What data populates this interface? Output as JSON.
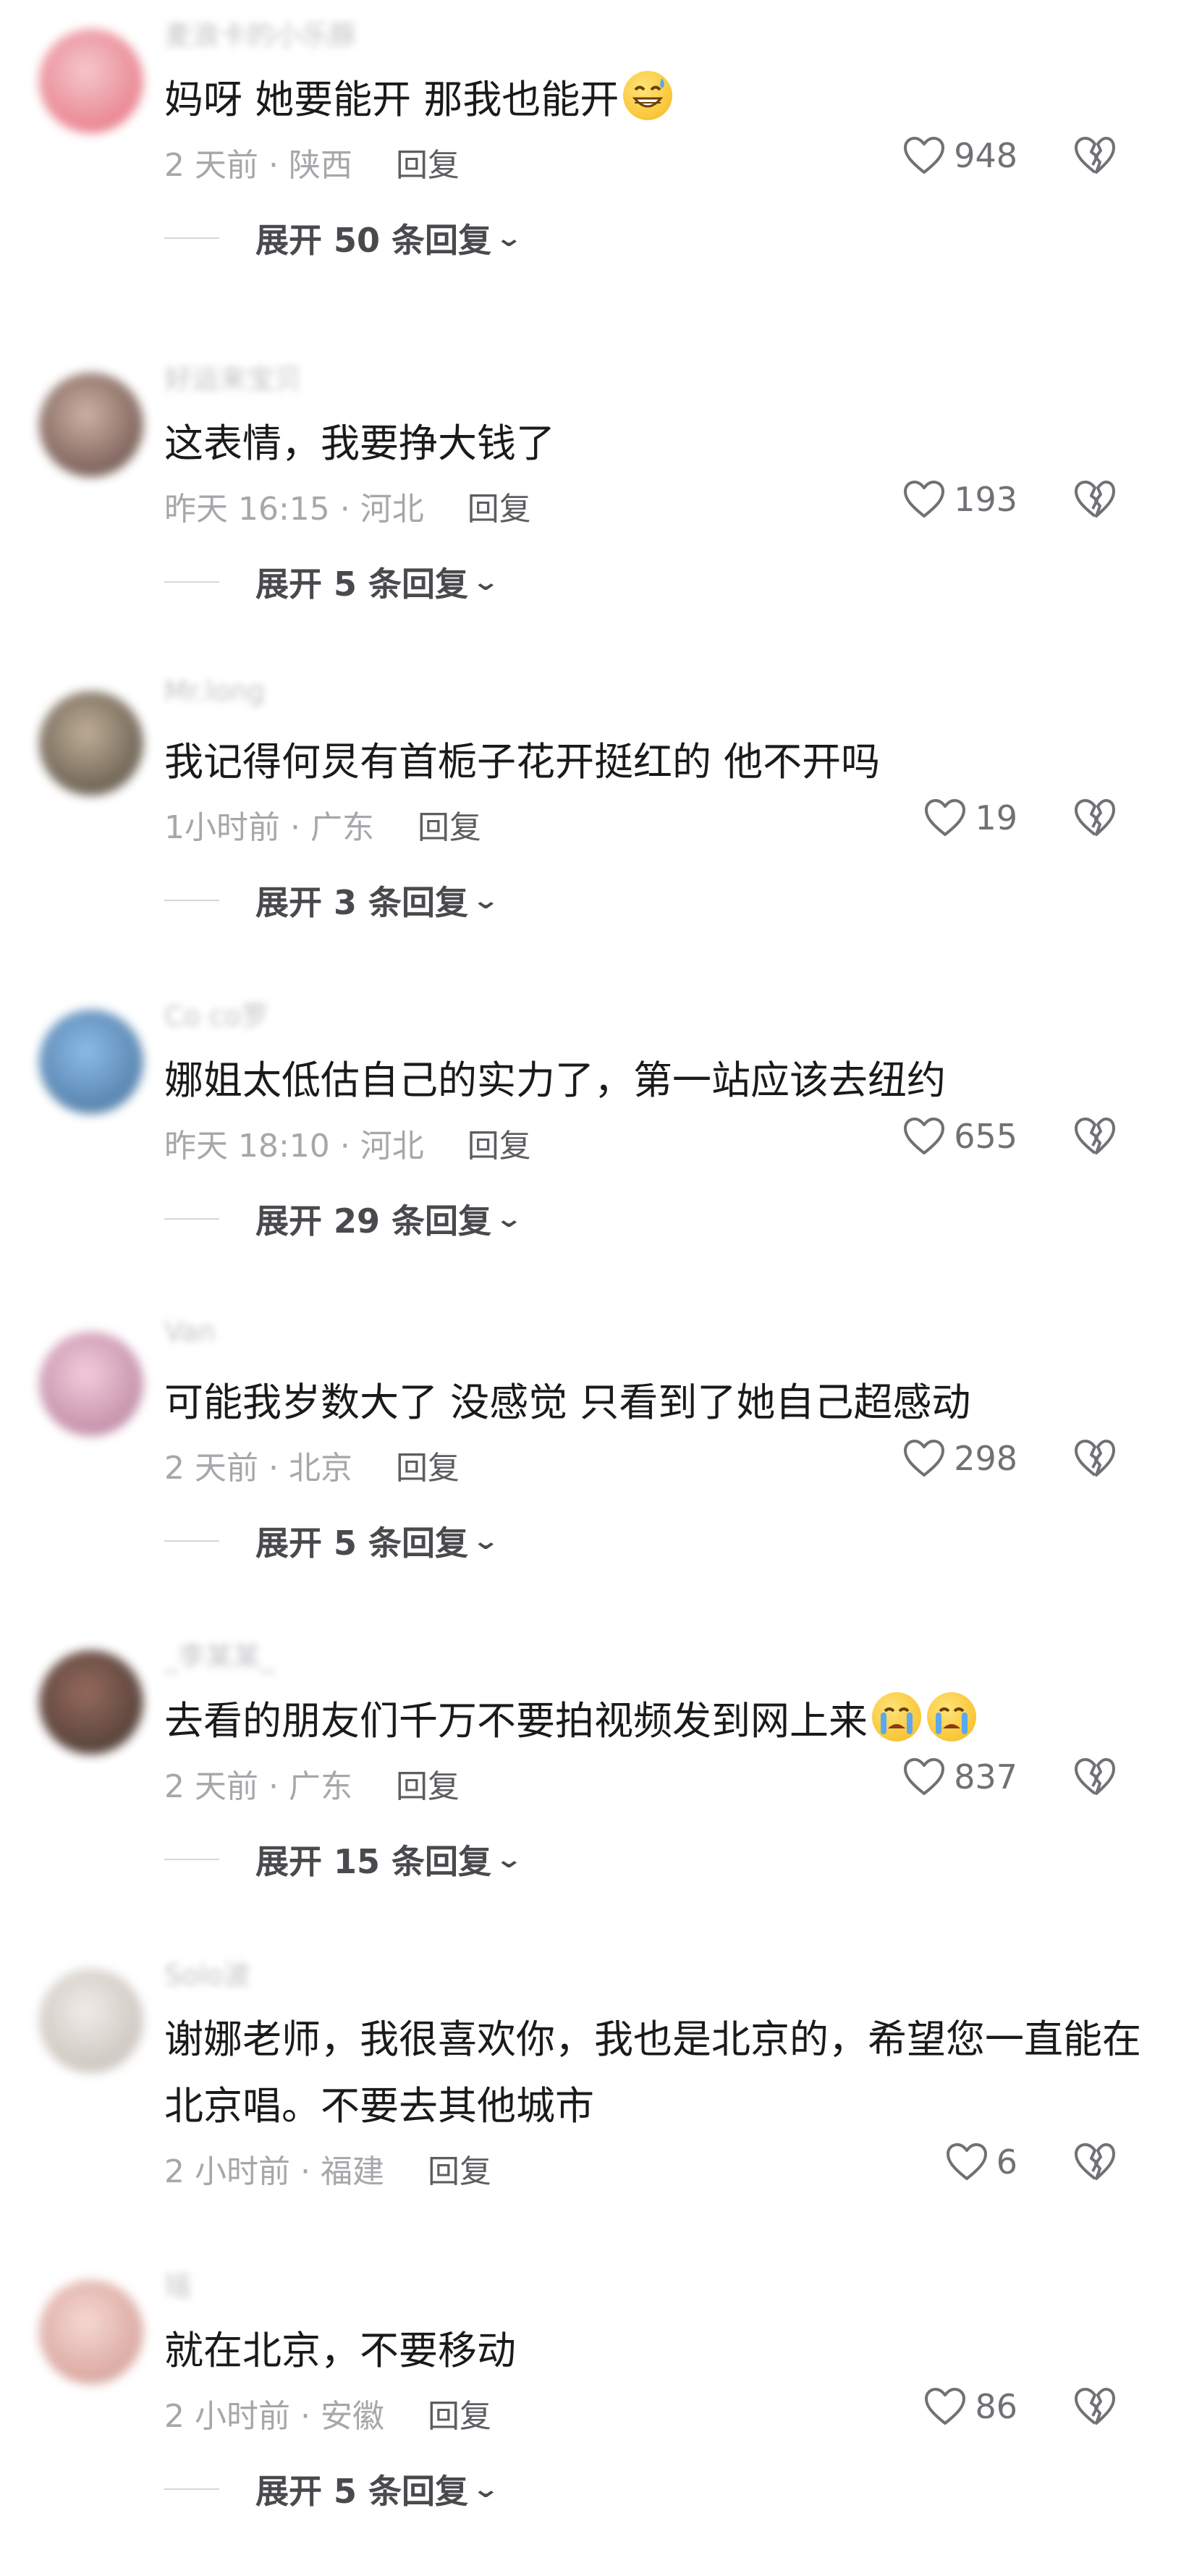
{
  "comments": [
    {
      "username": "麦浪卡的小乐豚",
      "text": "妈呀 她要能开 那我也能开",
      "emoji": [
        "grin-sweat"
      ],
      "time": "2 天前",
      "location": "陕西",
      "reply": "回复",
      "likes": "948",
      "expand": "展开 50 条回复",
      "avatar_colors": [
        "#f4c1c6",
        "#e35b6c"
      ]
    },
    {
      "username": "好运来宝贝",
      "text": "这表情，我要挣大钱了",
      "emoji": [],
      "time": "昨天 16:15",
      "location": "河北",
      "reply": "回复",
      "likes": "193",
      "expand": "展开 5 条回复",
      "avatar_colors": [
        "#c9a89a",
        "#4a2f28"
      ]
    },
    {
      "username": "Mr.long",
      "text": "我记得何炅有首栀子花开挺红的 他不开吗",
      "emoji": [],
      "time": "1小时前",
      "location": "广东",
      "reply": "回复",
      "likes": "19",
      "expand": "展开 3 条回复",
      "avatar_colors": [
        "#b8a58a",
        "#3a3128"
      ]
    },
    {
      "username": "Co co罗",
      "text": "娜姐太低估自己的实力了，第一站应该去纽约",
      "emoji": [],
      "time": "昨天 18:10",
      "location": "河北",
      "reply": "回复",
      "likes": "655",
      "expand": "展开 29 条回复",
      "avatar_colors": [
        "#7fb4e6",
        "#2f5d8a"
      ]
    },
    {
      "username": "Van",
      "text": "可能我岁数大了 没感觉 只看到了她自己超感动",
      "emoji": [],
      "time": "2 天前",
      "location": "北京",
      "reply": "回复",
      "likes": "298",
      "expand": "展开 5 条回复",
      "avatar_colors": [
        "#f2c6d8",
        "#a86b8a"
      ]
    },
    {
      "username": "_李某某_",
      "text": "去看的朋友们千万不要拍视频发到网上来",
      "emoji": [
        "crying",
        "crying"
      ],
      "time": "2 天前",
      "location": "广东",
      "reply": "回复",
      "likes": "837",
      "expand": "展开 15 条回复",
      "avatar_colors": [
        "#8a5a4a",
        "#2a1d19"
      ]
    },
    {
      "username": "Solo波",
      "text": "谢娜老师，我很喜欢你，我也是北京的，希望您一直能在北京唱。不要去其他城市",
      "emoji": [],
      "time": "2 小时前",
      "location": "福建",
      "reply": "回复",
      "likes": "6",
      "expand": "",
      "avatar_colors": [
        "#efeae6",
        "#b9b0a8"
      ]
    },
    {
      "username": "瑶",
      "text": "就在北京，不要移动",
      "emoji": [],
      "time": "2 小时前",
      "location": "安徽",
      "reply": "回复",
      "likes": "86",
      "expand": "展开 5 条回复",
      "avatar_colors": [
        "#f6d4cf",
        "#c98a80"
      ]
    }
  ],
  "icons": {
    "like": "heart-outline-icon",
    "dislike": "broken-heart-icon",
    "expand": "chevron-down-icon"
  },
  "colors": {
    "text": "#1a1a1a",
    "meta": "#a7a7ab",
    "reply": "#5d5d62",
    "expand": "#4a4a4e"
  }
}
